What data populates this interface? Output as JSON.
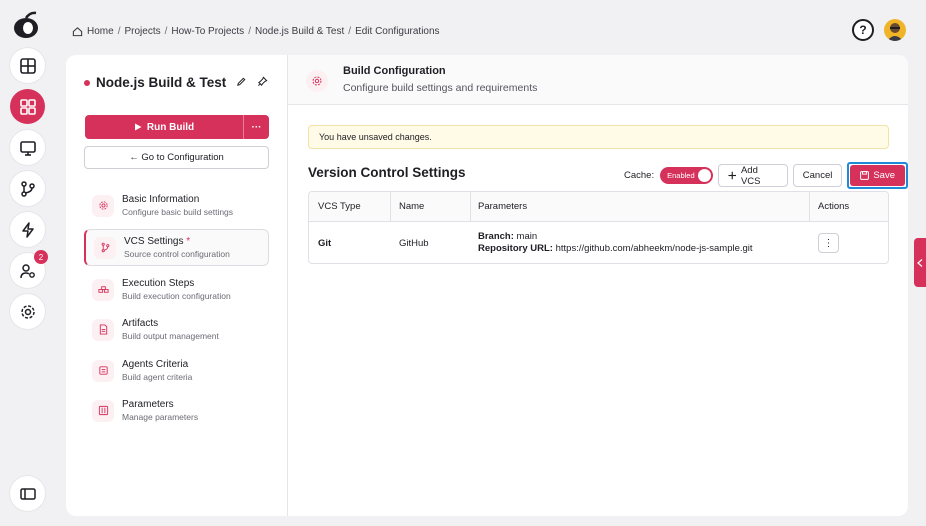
{
  "breadcrumb": {
    "items": [
      "Home",
      "Projects",
      "How-To Projects",
      "Node.js Build & Test",
      "Edit Configurations"
    ],
    "separator": "/"
  },
  "rail": {
    "items": [
      {
        "name": "dashboard",
        "icon": "layout-icon"
      },
      {
        "name": "projects",
        "icon": "grid-icon",
        "active": true
      },
      {
        "name": "monitor",
        "icon": "monitor-icon"
      },
      {
        "name": "version-control",
        "icon": "git-branch-icon"
      },
      {
        "name": "automation",
        "icon": "lightning-icon"
      },
      {
        "name": "user-settings",
        "icon": "user-gear-icon",
        "badge": "2"
      },
      {
        "name": "settings",
        "icon": "gear-icon"
      }
    ]
  },
  "project": {
    "title": "Node.js Build & Test",
    "run_label": "Run Build",
    "more_label": "···",
    "goto_label": "← Go to Configuration"
  },
  "nav": [
    {
      "title": "Basic Information",
      "subtitle": "Configure basic build settings",
      "icon": "gear-icon"
    },
    {
      "title": "VCS Settings",
      "subtitle": "Source control configuration",
      "icon": "git-branch-icon",
      "required": "*",
      "active": true
    },
    {
      "title": "Execution Steps",
      "subtitle": "Build execution configuration",
      "icon": "steps-icon"
    },
    {
      "title": "Artifacts",
      "subtitle": "Build output management",
      "icon": "file-icon"
    },
    {
      "title": "Agents Criteria",
      "subtitle": "Build agent criteria",
      "icon": "agent-icon"
    },
    {
      "title": "Parameters",
      "subtitle": "Manage parameters",
      "icon": "sliders-icon"
    }
  ],
  "header": {
    "title": "Build Configuration",
    "subtitle": "Configure build settings and requirements"
  },
  "alert": "You have unsaved changes.",
  "section": {
    "title": "Version Control Settings",
    "cache_label": "Cache:",
    "cache_state": "Enabled",
    "add_vcs_label": "Add VCS",
    "cancel_label": "Cancel",
    "save_label": "Save"
  },
  "table": {
    "columns": [
      "VCS Type",
      "Name",
      "Parameters",
      "Actions"
    ],
    "rows": [
      {
        "type": "Git",
        "name": "GitHub",
        "branch_label": "Branch:",
        "branch": "main",
        "repo_label": "Repository URL:",
        "repo": "https://github.com/abheekm/node-js-sample.git",
        "action": "⋮"
      }
    ]
  },
  "colors": {
    "accent": "#d6315b",
    "alert_bg": "#fffbe6",
    "focus": "#1f8ad8"
  }
}
